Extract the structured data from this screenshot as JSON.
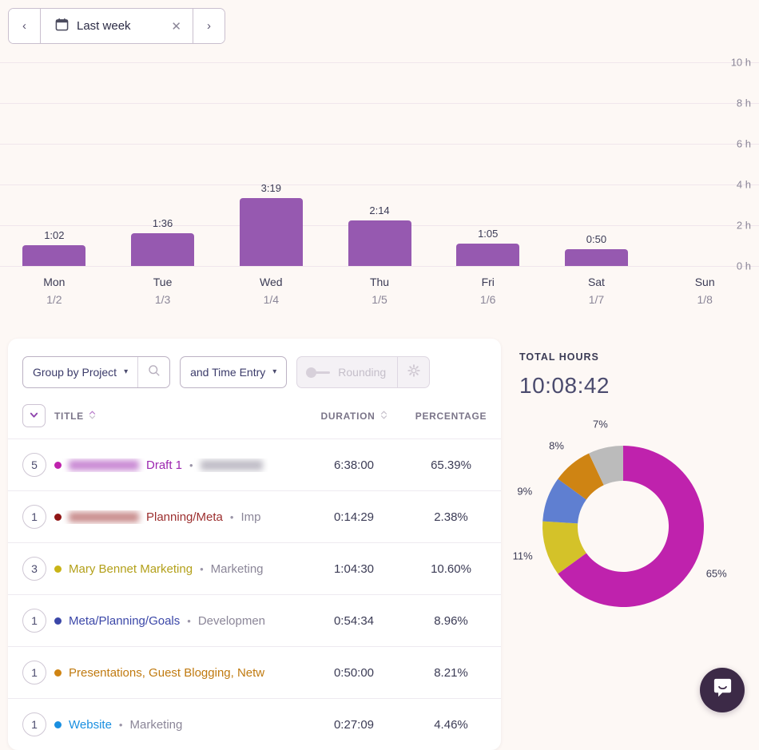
{
  "date_range": {
    "label": "Last week",
    "prev_label": "‹",
    "next_label": "›",
    "clear_label": "✕",
    "calendar_icon": "calendar-icon"
  },
  "chart_data": [
    {
      "type": "bar",
      "title": "",
      "xlabel": "",
      "ylabel": "",
      "ylim": [
        0,
        10
      ],
      "yunit": "h",
      "grid": true,
      "bar_color": "#9659b0",
      "ytick_labels": [
        "10 h",
        "8 h",
        "6 h",
        "4 h",
        "2 h",
        "0 h"
      ],
      "ytick_values": [
        10,
        8,
        6,
        4,
        2,
        0
      ],
      "categories": [
        "Mon",
        "Tue",
        "Wed",
        "Thu",
        "Fri",
        "Sat",
        "Sun"
      ],
      "category_dates": [
        "1/2",
        "1/3",
        "1/4",
        "1/5",
        "1/6",
        "1/7",
        "1/8"
      ],
      "data_labels": [
        "1:02",
        "1:36",
        "3:19",
        "2:14",
        "1:05",
        "0:50",
        ""
      ],
      "values": [
        1.033,
        1.6,
        3.317,
        2.233,
        1.083,
        0.833,
        0
      ]
    },
    {
      "type": "pie",
      "title": "",
      "donut": true,
      "legend_position": "none",
      "labels": [
        "65%",
        "11%",
        "9%",
        "8%",
        "7%"
      ],
      "values": [
        65,
        11,
        9,
        8,
        7
      ],
      "colors": [
        "#bf22ad",
        "#d4c229",
        "#5f7fd1",
        "#cf8413",
        "#bbbbbb"
      ]
    }
  ],
  "toolbar": {
    "group_by": {
      "value": "Group by Project",
      "caret": "▾",
      "search_icon": "search-icon"
    },
    "subgroup": {
      "value": "and Time Entry",
      "caret": "▾"
    },
    "rounding": {
      "label": "Rounding",
      "enabled": false,
      "gear_icon": "gear-icon"
    }
  },
  "table": {
    "expand_all_icon": "chevron-down-icon",
    "columns": [
      {
        "key": "title",
        "label": "TITLE",
        "sortable": true
      },
      {
        "key": "duration",
        "label": "DURATION",
        "sortable": true
      },
      {
        "key": "percentage",
        "label": "PERCENTAGE",
        "sortable": false
      }
    ],
    "rows": [
      {
        "count": "5",
        "dot_color": "#bf22ad",
        "title_redacted_before": true,
        "title_redacted_before_width": 88,
        "title": "Draft 1",
        "title_color": "#9c27b0",
        "separator": "•",
        "secondary": "",
        "secondary_redacted": true,
        "secondary_redacted_width": 78,
        "duration": "6:38:00",
        "percentage": "65.39%"
      },
      {
        "count": "1",
        "dot_color": "#901515",
        "title_redacted_before": true,
        "title_redacted_before_width": 88,
        "title": "Planning/Meta",
        "title_color": "#9c2f2f",
        "separator": "•",
        "secondary": "Imp",
        "secondary_redacted": false,
        "duration": "0:14:29",
        "percentage": "2.38%"
      },
      {
        "count": "3",
        "dot_color": "#c9b417",
        "title_redacted_before": false,
        "title": "Mary Bennet Marketing",
        "title_color": "#b3a01a",
        "separator": "•",
        "secondary": "Marketing",
        "secondary_redacted": false,
        "duration": "1:04:30",
        "percentage": "10.60%"
      },
      {
        "count": "1",
        "dot_color": "#3b47a8",
        "title_redacted_before": false,
        "title": "Meta/Planning/Goals",
        "title_color": "#3b47a8",
        "separator": "•",
        "secondary": "Developmen",
        "secondary_redacted": false,
        "duration": "0:54:34",
        "percentage": "8.96%"
      },
      {
        "count": "1",
        "dot_color": "#cf8413",
        "title_redacted_before": false,
        "title": "Presentations, Guest Blogging, Netw",
        "title_color": "#c07a10",
        "separator": "",
        "secondary": "",
        "secondary_redacted": false,
        "duration": "0:50:00",
        "percentage": "8.21%"
      },
      {
        "count": "1",
        "dot_color": "#1a8fe0",
        "title_redacted_before": false,
        "title": "Website",
        "title_color": "#1a8fe0",
        "separator": "•",
        "secondary": "Marketing",
        "secondary_redacted": false,
        "duration": "0:27:09",
        "percentage": "4.46%"
      }
    ]
  },
  "summary": {
    "total_hours_label": "TOTAL HOURS",
    "total_hours_value": "10:08:42"
  },
  "support": {
    "chat_icon": "chat-bubble-icon"
  },
  "colors": {
    "page_background": "#fdf8f5",
    "bar": "#9659b0",
    "accent_purple": "#9659b0",
    "intercom": "#3c2a47"
  }
}
